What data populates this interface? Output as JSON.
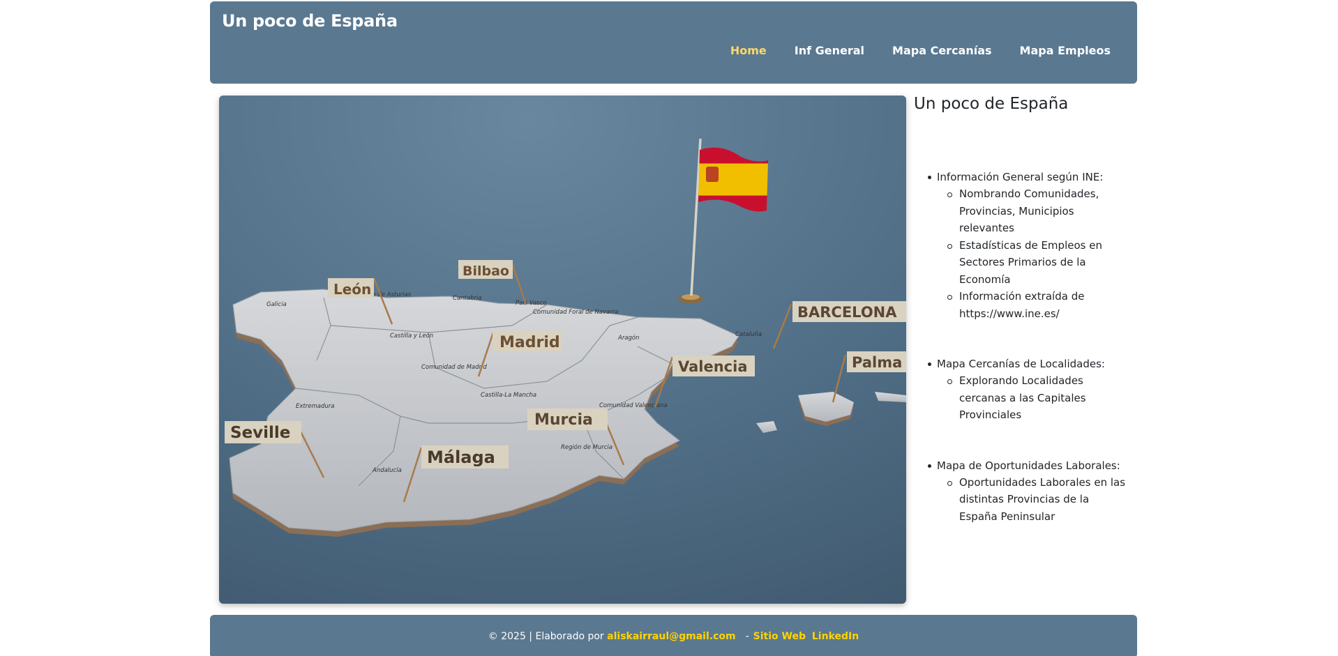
{
  "header": {
    "brand": "Un poco de España",
    "nav": [
      {
        "label": "Home",
        "active": true
      },
      {
        "label": "Inf General",
        "active": false
      },
      {
        "label": "Mapa Cercanías",
        "active": false
      },
      {
        "label": "Mapa Empleos",
        "active": false
      }
    ]
  },
  "hero": {
    "city_labels": [
      "León",
      "Bilbao",
      "Madrid",
      "BARCELONA",
      "Valencia",
      "Palma",
      "Seville",
      "Murcia",
      "Málaga"
    ],
    "region_labels": [
      "Galicia",
      "Castilla y León",
      "Comunidad de Madrid",
      "Aragón",
      "Cataluña",
      "Castilla-La Mancha",
      "Extremadura",
      "Andalucía",
      "Comunidad Valenciana",
      "Región de Murcia",
      "País Vasco",
      "Comunidad Foral de Navarra",
      "Cantabria",
      "Principado de Asturias"
    ]
  },
  "aside": {
    "title": "Un poco de España",
    "topics": [
      {
        "heading": "Información General según INE:",
        "items": [
          "Nombrando Comunidades, Provincias, Municipios relevantes",
          "Estadísticas de Empleos en Sectores Primarios de la Economía",
          "Información extraída de https://www.ine.es/"
        ]
      },
      {
        "heading": "Mapa Cercanías de Localidades:",
        "items": [
          "Explorando Localidades cercanas a las Capitales Provinciales"
        ]
      },
      {
        "heading": "Mapa de Oportunidades Laborales:",
        "items": [
          "Oportunidades Laborales en las distintas Provincias de la España Peninsular"
        ]
      }
    ]
  },
  "footer": {
    "prefix": "© 2025 | Elaborado por",
    "email": "aliskairraul@gmail.com",
    "dash": "-",
    "site": "Sitio Web",
    "linkedin": "LinkedIn"
  },
  "colors": {
    "bar": "#5a7890",
    "nav_active": "#ffd86b",
    "footer_link": "#ffd400"
  }
}
